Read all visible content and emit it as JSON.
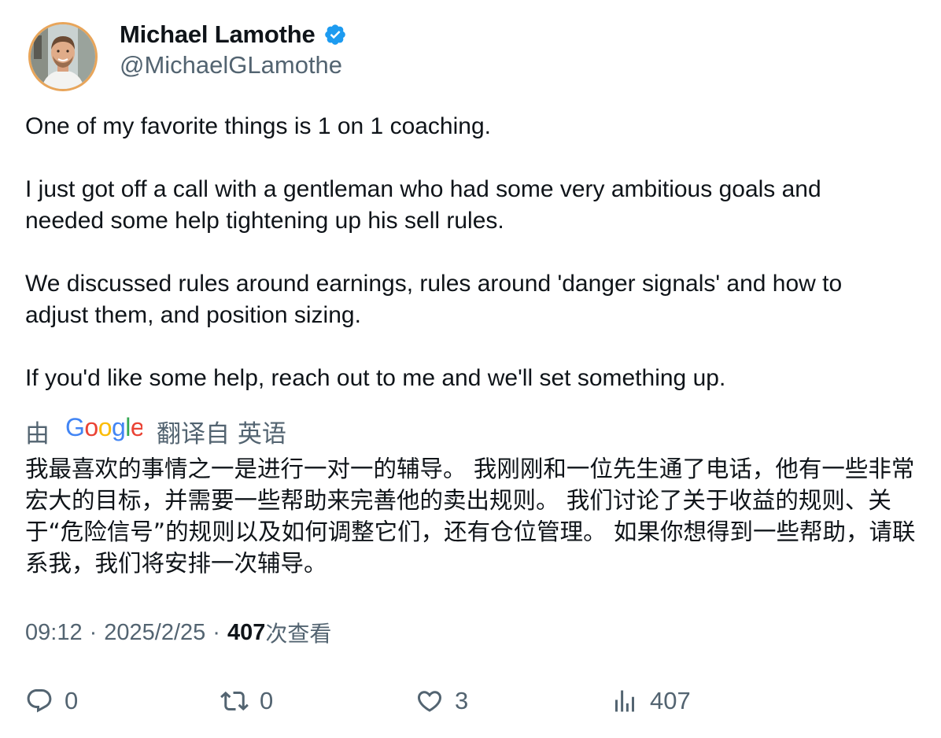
{
  "author": {
    "display_name": "Michael Lamothe",
    "handle": "@MichaelGLamothe",
    "verified": true,
    "verified_icon": "verified-badge-icon",
    "verified_color": "#1d9bf0"
  },
  "tweet": {
    "paragraphs": [
      "One of my favorite things is 1 on 1 coaching.",
      "I just got off a call with a gentleman who had some very ambitious goals and",
      "needed some help tightening up his sell rules.",
      "We discussed rules around earnings, rules around 'danger signals' and how to",
      "adjust them, and position sizing.",
      "If you'd like some help, reach out to me and we'll set something up."
    ]
  },
  "translation": {
    "prefix": "由",
    "provider": "Google",
    "suffix": "翻译自 英语",
    "text": "我最喜欢的事情之一是进行一对一的辅导。 我刚刚和一位先生通了电话，他有一些非常宏大的目标，并需要一些帮助来完善他的卖出规则。 我们讨论了关于收益的规则、关于“危险信号”的规则以及如何调整它们，还有仓位管理。 如果你想得到一些帮助，请联系我，我们将安排一次辅导。"
  },
  "meta": {
    "time": "09:12",
    "separator": "·",
    "date": "2025/2/25",
    "views_count": "407",
    "views_label": "次查看"
  },
  "actions": {
    "reply": {
      "icon": "reply-icon",
      "count": "0"
    },
    "retweet": {
      "icon": "retweet-icon",
      "count": "0"
    },
    "like": {
      "icon": "heart-icon",
      "count": "3"
    },
    "views": {
      "icon": "analytics-icon",
      "count": "407"
    }
  },
  "colors": {
    "text_primary": "#0f1419",
    "text_secondary": "#536471",
    "verified": "#1d9bf0",
    "avatar_ring": "#e8a55a"
  }
}
